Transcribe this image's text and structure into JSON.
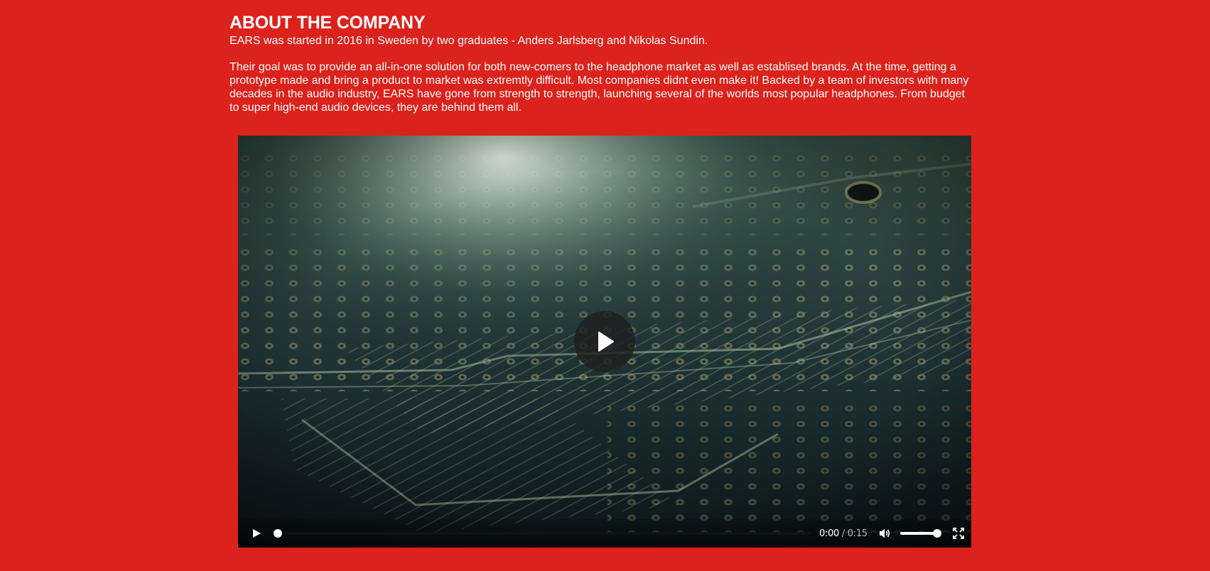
{
  "about": {
    "title": "ABOUT THE COMPANY",
    "lead": "EARS was started in 2016 in Sweden by two graduates - Anders Jarlsberg and Nikolas Sundin.",
    "body": "Their goal was to provide an all-in-one solution for both new-comers to the headphone market as well as establised brands. At the time, getting a prototype made and bring a product to market was extremtly difficult. Most companies didnt even make it! Backed by a team of investors with many decades in the audio industry, EARS have gone from strength to strength, launching several of the worlds most popular headphones. From budget to super high-end audio devices, they are behind them all."
  },
  "video": {
    "poster_subject": "circuit-board",
    "current_time": "0:00",
    "separator": "/",
    "duration": "0:15",
    "progress_fraction": 0,
    "volume_fraction": 1,
    "icons": {
      "big_play": "play-icon",
      "play": "play-icon",
      "mute": "volume-icon",
      "fullscreen": "fullscreen-icon"
    }
  },
  "colors": {
    "background": "#dc221c",
    "text": "#ffffff"
  }
}
